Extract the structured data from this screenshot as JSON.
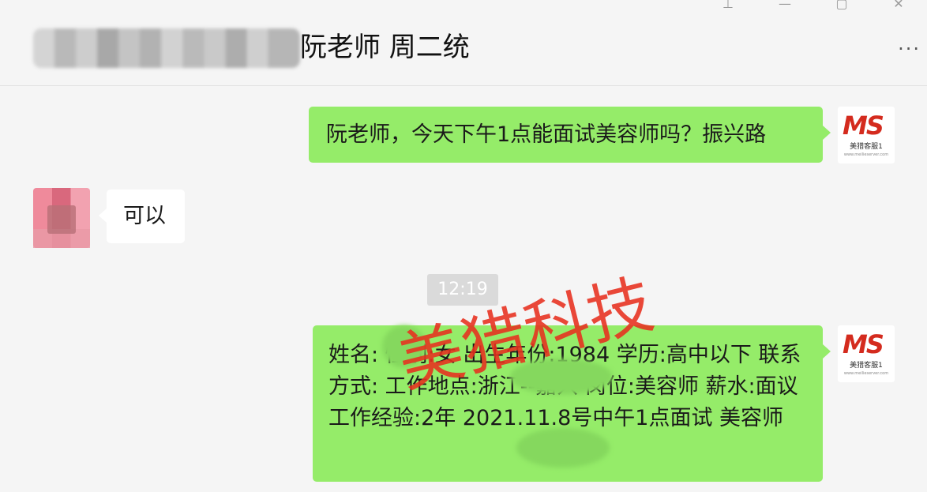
{
  "window": {
    "controls": [
      "⊥",
      "—",
      "▢",
      "✕"
    ]
  },
  "header": {
    "title": "阮老师 周二统",
    "more_label": "···"
  },
  "brand_avatar": {
    "logo_text": "MS",
    "caption": "美猎客服1",
    "url": "www.meilieserver.com"
  },
  "messages": [
    {
      "direction": "out",
      "text": "阮老师，今天下午1点能面试美容师吗？振兴路"
    },
    {
      "direction": "in",
      "text": "可以"
    },
    {
      "type": "time",
      "text": "12:19"
    },
    {
      "direction": "out",
      "text": "姓名:    性别:女 出生年份:1984 学历:高中以下 联系方式:         工作地点:浙江--嘉兴 岗位:美容师 薪水:面议 工作经验:2年 2021.11.8号中午1点面试           美容师"
    }
  ],
  "watermark": {
    "text": "美猎科技",
    "color": "#e8301f"
  },
  "colors": {
    "outgoing_bubble": "#95ec69",
    "incoming_bubble": "#ffffff",
    "background": "#f5f5f5"
  }
}
